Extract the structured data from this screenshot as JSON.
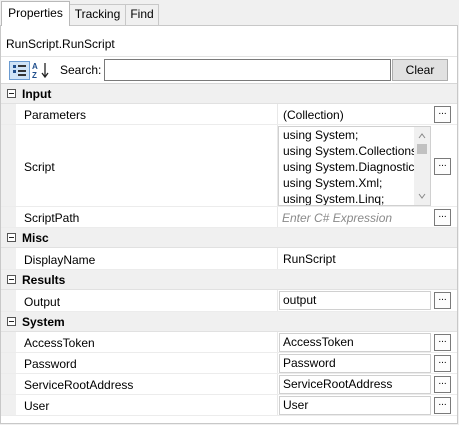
{
  "tabs": [
    {
      "label": "Properties",
      "active": true
    },
    {
      "label": "Tracking",
      "active": false
    },
    {
      "label": "Find",
      "active": false
    }
  ],
  "title": "RunScript.RunScript",
  "toolbar": {
    "categorized_icon": "categorized-icon",
    "sort_icon": "sort-az-icon",
    "search_label": "Search:",
    "search_value": "",
    "clear_label": "Clear"
  },
  "ellipsis_label": "...",
  "categories": {
    "input": {
      "label": "Input",
      "props": {
        "parameters": {
          "name": "Parameters",
          "value": "(Collection)"
        },
        "script": {
          "name": "Script",
          "lines": [
            "using System;",
            "using System.Collections.",
            "using System.Diagnostics",
            "using System.Xml;",
            "using System.Linq;"
          ]
        },
        "scriptpath": {
          "name": "ScriptPath",
          "placeholder": "Enter C# Expression"
        }
      }
    },
    "misc": {
      "label": "Misc",
      "props": {
        "displayname": {
          "name": "DisplayName",
          "value": "RunScript"
        }
      }
    },
    "results": {
      "label": "Results",
      "props": {
        "output": {
          "name": "Output",
          "value": "output"
        }
      }
    },
    "system": {
      "label": "System",
      "props": {
        "accesstoken": {
          "name": "AccessToken",
          "value": "AccessToken"
        },
        "password": {
          "name": "Password",
          "value": "Password"
        },
        "servicerootaddress": {
          "name": "ServiceRootAddress",
          "value": "ServiceRootAddress"
        },
        "user": {
          "name": "User",
          "value": "User"
        }
      }
    }
  },
  "colors": {
    "panel_bg": "#ffffff",
    "category_bg": "#f0f0f0",
    "selected_toolbar_btn": "#cfe3f6",
    "placeholder_text": "#8a8a8a"
  }
}
